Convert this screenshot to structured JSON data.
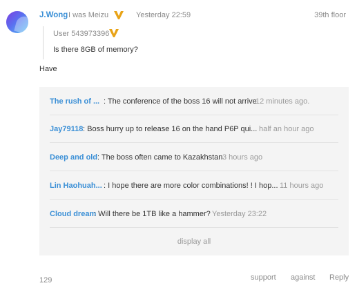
{
  "post": {
    "username": "J.Wong",
    "device": "I was Meizu",
    "time": "Yesterday 22:59",
    "floor": "39th floor",
    "quote": {
      "user": "User 543973396",
      "text": "Is there 8GB of memory?"
    },
    "body": "Have"
  },
  "replies": [
    {
      "user": "The rush of ...",
      "text": ": The conference of the boss 16 will not arrive",
      "time": "12 minutes ago."
    },
    {
      "user": "Jay79118",
      "text": ": Boss hurry up to release 16 on the hand P6P qui...",
      "time": "half an hour ago"
    },
    {
      "user": "Deep and old",
      "text": ": The boss often came to Kazakhstan",
      "time": "3 hours ago"
    },
    {
      "user": "Lin Haohuah...",
      "text": ": I hope there are more color combinations! ! I hop...",
      "time": "11 hours ago"
    },
    {
      "user": "Cloud dream",
      "text": ": Will there be 1TB like a hammer?",
      "time": "Yesterday 23:22"
    }
  ],
  "display_all": "display all",
  "footer": {
    "count": "129",
    "support": "support",
    "against": "against",
    "reply": "Reply"
  },
  "colors": {
    "link_blue": "#3a8fd6",
    "badge_gold": "#e8a317",
    "reply_bg": "#f4f4f4"
  }
}
